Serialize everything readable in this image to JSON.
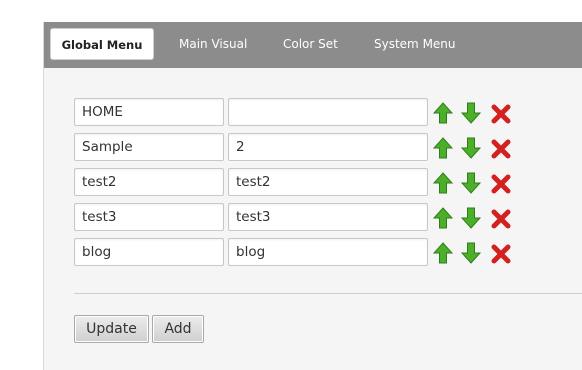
{
  "tabs": [
    {
      "label": "Global Menu",
      "active": true
    },
    {
      "label": "Main Visual",
      "active": false
    },
    {
      "label": "Color Set",
      "active": false
    },
    {
      "label": "System Menu",
      "active": false
    }
  ],
  "menu_rows": [
    {
      "name": "HOME",
      "value": ""
    },
    {
      "name": "Sample",
      "value": "2"
    },
    {
      "name": "test2",
      "value": "test2"
    },
    {
      "name": "test3",
      "value": "test3"
    },
    {
      "name": "blog",
      "value": "blog"
    }
  ],
  "icons": {
    "up": "arrow-up-icon",
    "down": "arrow-down-icon",
    "delete": "delete-icon"
  },
  "buttons": {
    "update_label": "Update",
    "add_label": "Add"
  },
  "colors": {
    "tab_bar": "#8c8c8c",
    "arrow_green": "#4caf2a",
    "delete_red": "#d32020"
  }
}
